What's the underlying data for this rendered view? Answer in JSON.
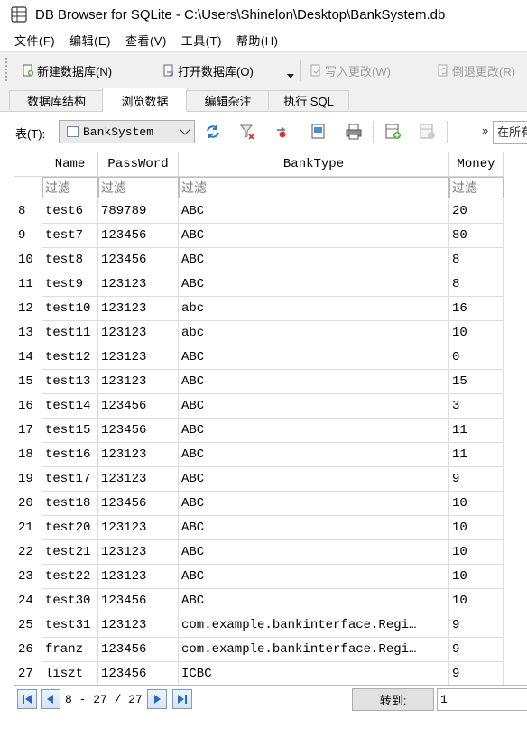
{
  "window": {
    "title": "DB Browser for SQLite - C:\\Users\\Shinelon\\Desktop\\BankSystem.db"
  },
  "menu": [
    "文件(F)",
    "编辑(E)",
    "查看(V)",
    "工具(T)",
    "帮助(H)"
  ],
  "toolbar": {
    "new_db": "新建数据库(N)",
    "open_db": "打开数据库(O)",
    "write_changes": "写入更改(W)",
    "revert_changes": "倒退更改(R)"
  },
  "tabs": [
    "数据库结构",
    "浏览数据",
    "编辑杂注",
    "执行 SQL"
  ],
  "browse": {
    "table_label": "表(T):",
    "table_value": "BankSystem",
    "more": "»",
    "filter_all_placeholder": "在所有"
  },
  "grid": {
    "columns": [
      "Name",
      "PassWord",
      "BankType",
      "Money"
    ],
    "filter_placeholder": "过滤",
    "rows": [
      {
        "n": "8",
        "name": "test6",
        "pw": "789789",
        "type": "ABC",
        "money": "20"
      },
      {
        "n": "9",
        "name": "test7",
        "pw": "123456",
        "type": "ABC",
        "money": "80"
      },
      {
        "n": "10",
        "name": "test8",
        "pw": "123456",
        "type": "ABC",
        "money": "8"
      },
      {
        "n": "11",
        "name": "test9",
        "pw": "123123",
        "type": "ABC",
        "money": "8"
      },
      {
        "n": "12",
        "name": "test10",
        "pw": "123123",
        "type": "abc",
        "money": "16"
      },
      {
        "n": "13",
        "name": "test11",
        "pw": "123123",
        "type": "abc",
        "money": "10"
      },
      {
        "n": "14",
        "name": "test12",
        "pw": "123123",
        "type": "ABC",
        "money": "0"
      },
      {
        "n": "15",
        "name": "test13",
        "pw": "123123",
        "type": "ABC",
        "money": "15"
      },
      {
        "n": "16",
        "name": "test14",
        "pw": "123456",
        "type": "ABC",
        "money": "3"
      },
      {
        "n": "17",
        "name": "test15",
        "pw": "123456",
        "type": "ABC",
        "money": "11"
      },
      {
        "n": "18",
        "name": "test16",
        "pw": "123123",
        "type": "ABC",
        "money": "11"
      },
      {
        "n": "19",
        "name": "test17",
        "pw": "123123",
        "type": "ABC",
        "money": "9"
      },
      {
        "n": "20",
        "name": "test18",
        "pw": "123456",
        "type": "ABC",
        "money": "10"
      },
      {
        "n": "21",
        "name": "test20",
        "pw": "123123",
        "type": "ABC",
        "money": "10"
      },
      {
        "n": "22",
        "name": "test21",
        "pw": "123123",
        "type": "ABC",
        "money": "10"
      },
      {
        "n": "23",
        "name": "test22",
        "pw": "123123",
        "type": "ABC",
        "money": "10"
      },
      {
        "n": "24",
        "name": "test30",
        "pw": "123456",
        "type": "ABC",
        "money": "10"
      },
      {
        "n": "25",
        "name": "test31",
        "pw": "123123",
        "type": "com.example.bankinterface.Regi…",
        "money": "9"
      },
      {
        "n": "26",
        "name": "franz",
        "pw": "123456",
        "type": "com.example.bankinterface.Regi…",
        "money": "9"
      },
      {
        "n": "27",
        "name": "liszt",
        "pw": "123456",
        "type": "ICBC",
        "money": "9"
      }
    ]
  },
  "nav": {
    "range_text": "8 - 27 / 27",
    "goto_label": "转到:",
    "goto_value": "1"
  }
}
